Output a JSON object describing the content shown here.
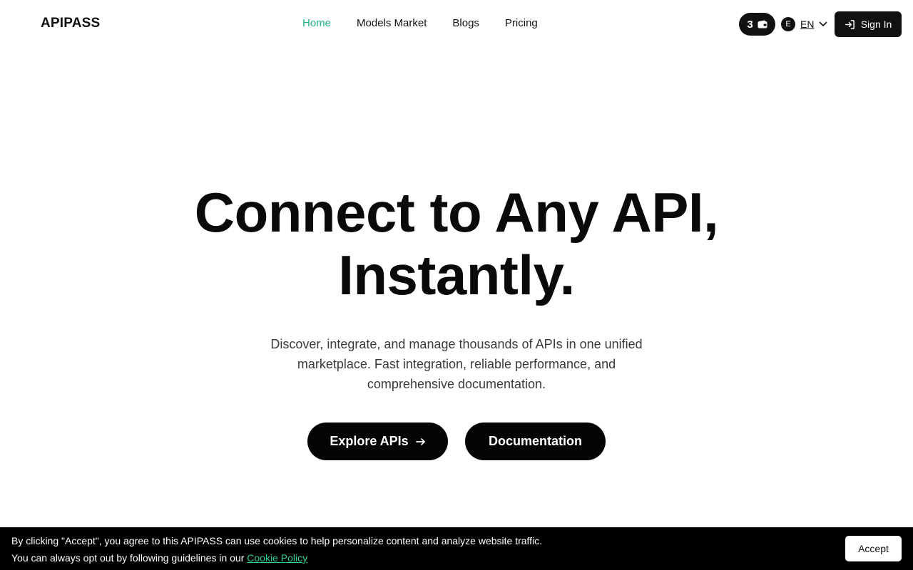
{
  "header": {
    "logo": "APIPASS",
    "nav": [
      {
        "label": "Home",
        "active": true
      },
      {
        "label": "Models Market",
        "active": false
      },
      {
        "label": "Blogs",
        "active": false
      },
      {
        "label": "Pricing",
        "active": false
      }
    ],
    "wallet_count": "3",
    "wallet_icon": "wallet-icon",
    "language": {
      "badge": "E",
      "label": "EN",
      "icon": "chevron-down-icon"
    },
    "signin_label": "Sign In",
    "signin_icon": "sign-in-icon"
  },
  "hero": {
    "title_line1": "Connect to Any API,",
    "title_line2": "Instantly.",
    "subtitle": "Discover, integrate, and manage thousands of APIs in one unified marketplace. Fast integration, reliable performance, and comprehensive documentation.",
    "primary_button": "Explore APIs",
    "primary_icon": "arrow-right-icon",
    "secondary_button": "Documentation"
  },
  "cookie_banner": {
    "line1": "By clicking \"Accept\", you agree to this APIPASS can use cookies to help personalize content and analyze website traffic.",
    "line2_prefix": "You can always opt out by following guidelines in our ",
    "link": "Cookie Policy",
    "accept_label": "Accept"
  },
  "colors": {
    "accent": "#20b38a",
    "dark": "#111111",
    "banner_bg": "#000000"
  }
}
